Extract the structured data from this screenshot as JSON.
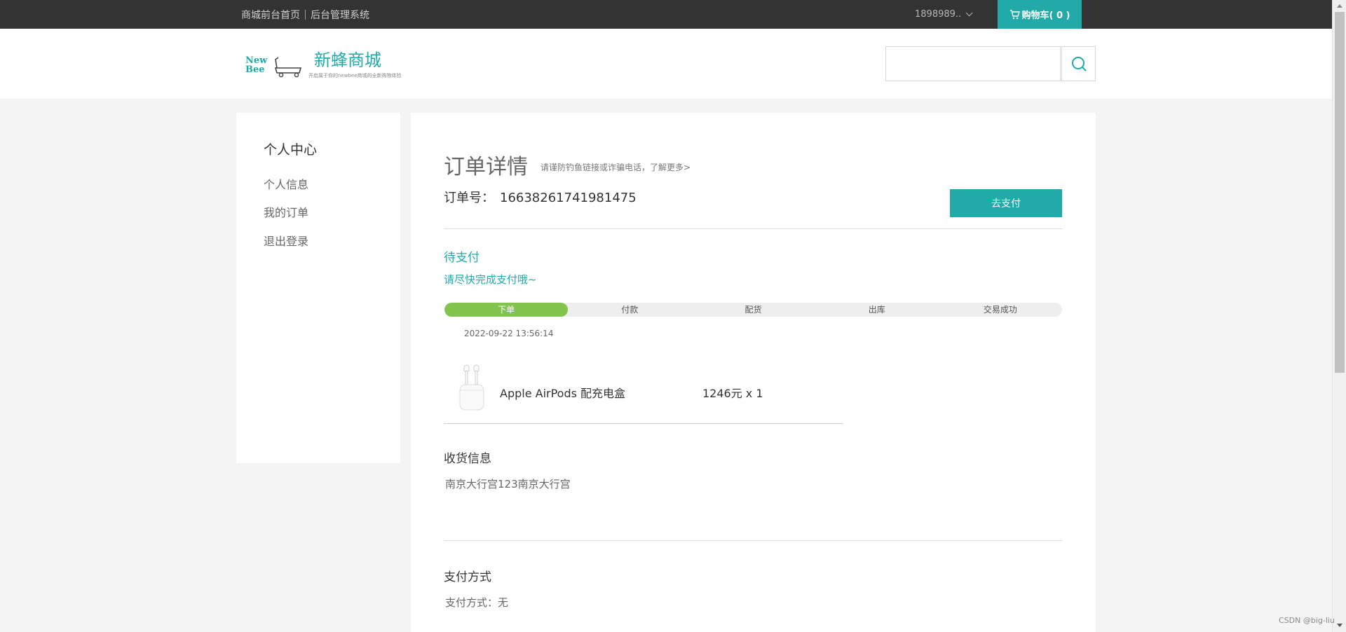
{
  "topbar": {
    "front_link": "商城前台首页",
    "admin_link": "后台管理系统",
    "username": "1898989..",
    "cart_label": "购物车( 0 )"
  },
  "header": {
    "logo_text_1": "New",
    "logo_text_2": "Bee",
    "site_name": "新蜂商城",
    "tagline": "开启属于你的newbee商城的全新购物体验",
    "search_placeholder": ""
  },
  "sidebar": {
    "title": "个人中心",
    "items": [
      {
        "label": "个人信息"
      },
      {
        "label": "我的订单"
      },
      {
        "label": "退出登录"
      }
    ]
  },
  "order": {
    "title": "订单详情",
    "tip": "请谨防钓鱼链接或诈骗电话，了解更多>",
    "order_no_label": "订单号：",
    "order_no": "16638261741981475",
    "pay_button": "去支付",
    "status": "待支付",
    "status_desc": "请尽快完成支付哦~",
    "progress_steps": [
      "下单",
      "付款",
      "配货",
      "出库",
      "交易成功"
    ],
    "progress_completed_steps": 1,
    "created_time": "2022-09-22 13:56:14",
    "items": [
      {
        "name": "Apple AirPods 配充电盒",
        "price_qty": "1246元 x 1",
        "icon": "airpods-image"
      }
    ]
  },
  "shipping": {
    "title": "收货信息",
    "address": "南京大行宫123南京大行宫"
  },
  "payment": {
    "title": "支付方式",
    "method_text": "支付方式：无"
  },
  "watermark": "CSDN @big-liu",
  "colors": {
    "accent": "#21aaa8",
    "progress_done": "#83c44e",
    "topbar_bg": "#333333"
  }
}
